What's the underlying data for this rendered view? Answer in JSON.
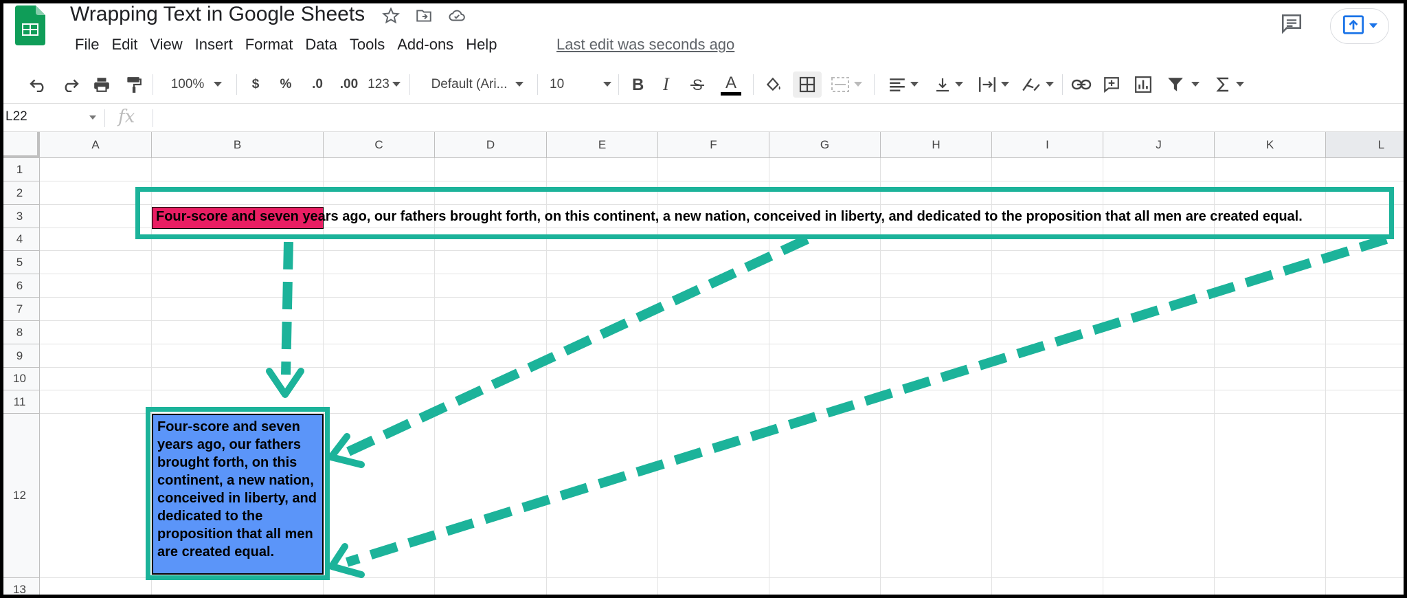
{
  "app": {
    "doc_title": "Wrapping Text in Google Sheets",
    "menu": [
      "File",
      "Edit",
      "View",
      "Insert",
      "Format",
      "Data",
      "Tools",
      "Add-ons",
      "Help"
    ],
    "last_edit": "Last edit was seconds ago"
  },
  "toolbar": {
    "zoom": "100%",
    "currency": "$",
    "percent": "%",
    "decrease_decimals": ".0",
    "increase_decimals": ".00",
    "more_formats": "123",
    "font_family": "Default (Ari...",
    "font_size": "10"
  },
  "formula_bar": {
    "cell_ref": "L22",
    "fx": "fx",
    "value": ""
  },
  "grid": {
    "columns": [
      "A",
      "B",
      "C",
      "D",
      "E",
      "F",
      "G",
      "H",
      "I",
      "J",
      "K",
      "L"
    ],
    "rows": [
      "1",
      "2",
      "3",
      "4",
      "5",
      "6",
      "7",
      "8",
      "9",
      "10",
      "11",
      "12",
      "13"
    ],
    "cell_b3_text": "Four-score and seven years ago, our fathers brought forth, on this continent, a new nation, conceived in liberty, and dedicated to the proposition that all men are created equal.",
    "cell_b12_text": "Four-score and seven years ago, our fathers brought forth, on this continent, a new nation, conceived in liberty, and dedicated to the proposition that all men are created equal.",
    "colors": {
      "b3_fill": "#e91e63",
      "b12_fill": "#5b95f9",
      "callout": "#1cb39a"
    }
  }
}
